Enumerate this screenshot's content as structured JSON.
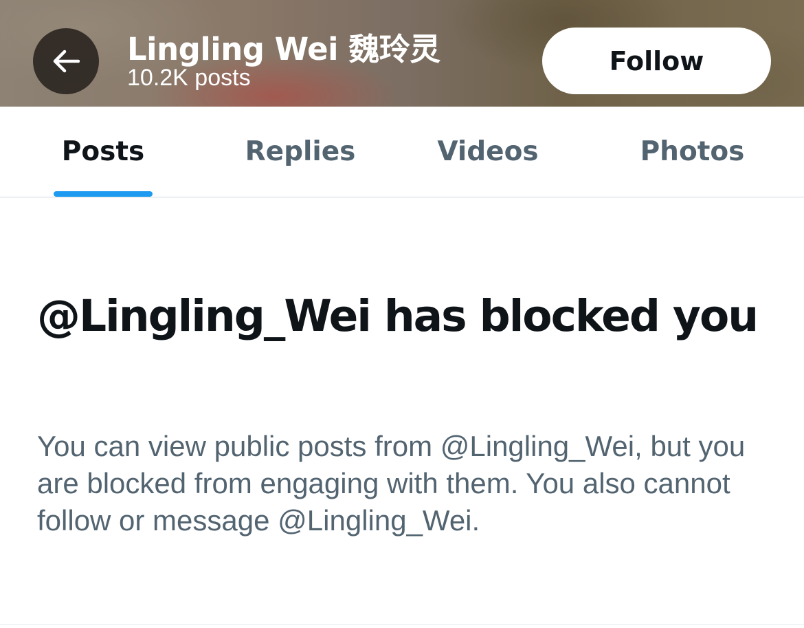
{
  "header": {
    "display_name": "Lingling Wei 魏玲灵",
    "post_count": "10.2K posts",
    "follow_label": "Follow"
  },
  "tabs": [
    {
      "label": "Posts",
      "active": true
    },
    {
      "label": "Replies",
      "active": false
    },
    {
      "label": "Videos",
      "active": false
    },
    {
      "label": "Photos",
      "active": false
    }
  ],
  "blocked_notice": {
    "title": "@Lingling_Wei has blocked you",
    "description": "You can view public posts from @Lingling_Wei, but you are blocked from engaging with them. You also cannot follow or message @Lingling_Wei."
  },
  "icons": {
    "back": "arrow-left-icon"
  },
  "colors": {
    "accent": "#1d9bf0",
    "text_primary": "#0f1419",
    "text_secondary": "#536471"
  }
}
